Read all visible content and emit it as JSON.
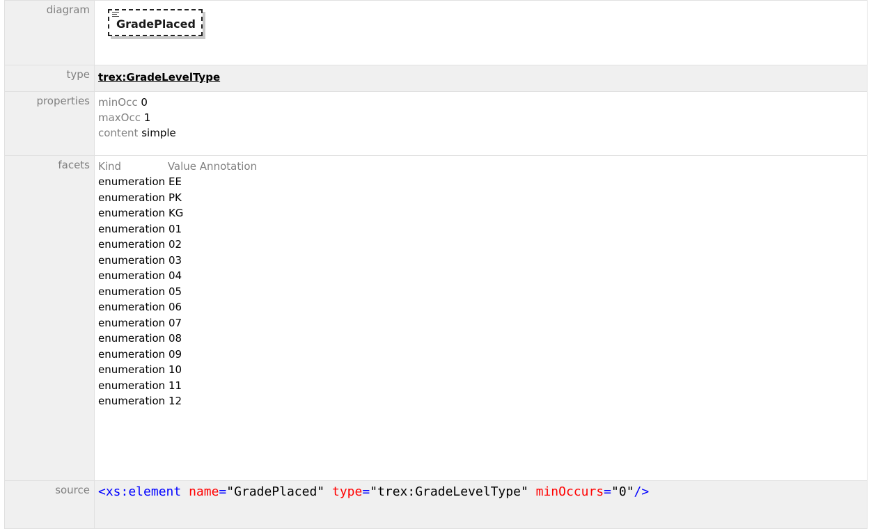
{
  "labels": {
    "diagram": "diagram",
    "type": "type",
    "properties": "properties",
    "facets": "facets",
    "source": "source"
  },
  "diagram": {
    "element_name": "GradePlaced",
    "icon": "list-icon"
  },
  "type": {
    "link_text": "trex:GradeLevelType"
  },
  "properties": [
    {
      "key": "minOcc",
      "value": "0"
    },
    {
      "key": "maxOcc",
      "value": "1"
    },
    {
      "key": "content",
      "value": "simple"
    }
  ],
  "facets": {
    "header": {
      "kind": "Kind",
      "value": "Value",
      "annotation": "Annotation"
    },
    "rows": [
      {
        "kind": "enumeration",
        "value": "EE"
      },
      {
        "kind": "enumeration",
        "value": "PK"
      },
      {
        "kind": "enumeration",
        "value": "KG"
      },
      {
        "kind": "enumeration",
        "value": "01"
      },
      {
        "kind": "enumeration",
        "value": "02"
      },
      {
        "kind": "enumeration",
        "value": "03"
      },
      {
        "kind": "enumeration",
        "value": "04"
      },
      {
        "kind": "enumeration",
        "value": "05"
      },
      {
        "kind": "enumeration",
        "value": "06"
      },
      {
        "kind": "enumeration",
        "value": "07"
      },
      {
        "kind": "enumeration",
        "value": "08"
      },
      {
        "kind": "enumeration",
        "value": "09"
      },
      {
        "kind": "enumeration",
        "value": "10"
      },
      {
        "kind": "enumeration",
        "value": "11"
      },
      {
        "kind": "enumeration",
        "value": "12"
      }
    ]
  },
  "source": {
    "tag_open": "<xs:element",
    "attr_name": "name",
    "val_name": "\"GradePlaced\"",
    "attr_type": "type",
    "val_type": "\"trex:GradeLevelType\"",
    "attr_min": "minOccurs",
    "val_min": "\"0\"",
    "tag_close": "/>"
  },
  "colors": {
    "label_bg": "#f0f0f0",
    "label_text": "#808080",
    "border": "#e0e0e0",
    "xml_tag": "#0000ff",
    "xml_attr": "#ff0000"
  }
}
